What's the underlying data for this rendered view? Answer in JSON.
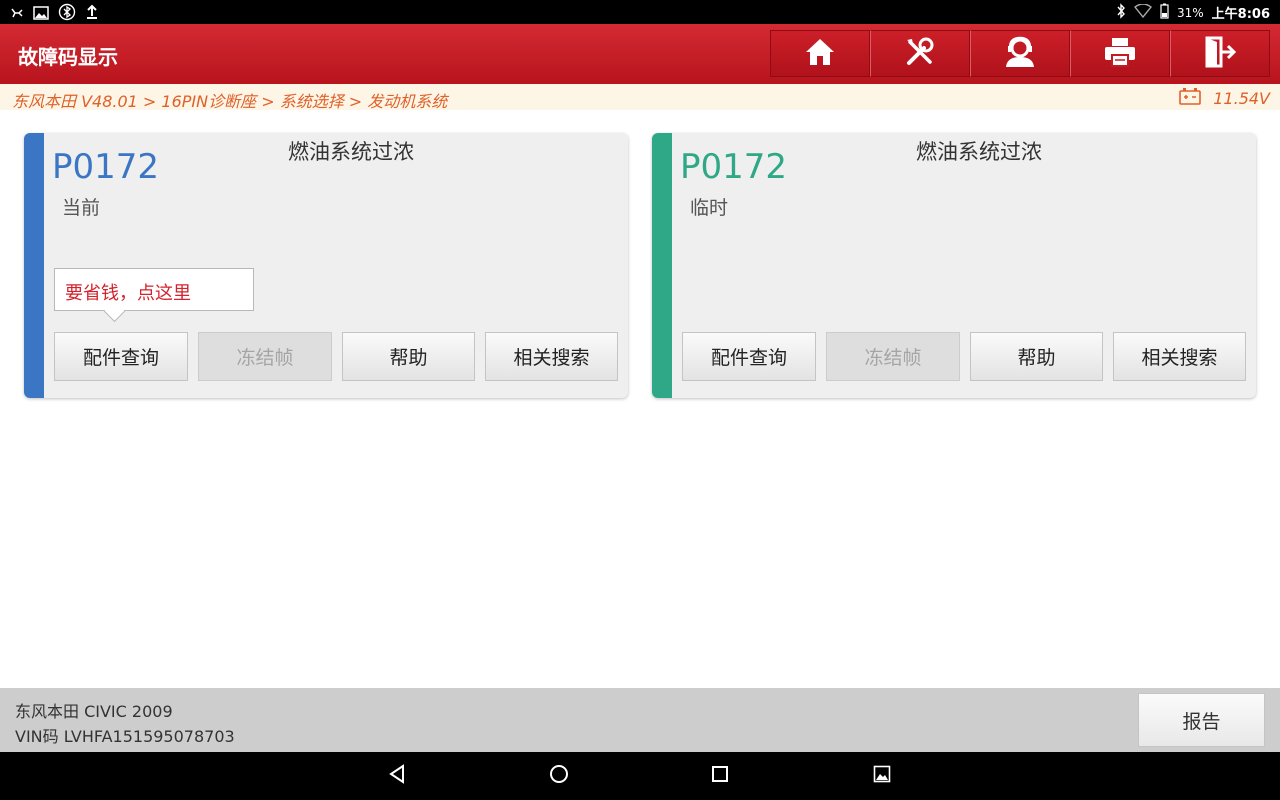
{
  "status_bar": {
    "battery_pct": "31%",
    "time": "上午8:06"
  },
  "header": {
    "title": "故障码显示",
    "toolbar": [
      {
        "icon": "home-icon"
      },
      {
        "icon": "diagnostic-tools-icon"
      },
      {
        "icon": "support-agent-icon"
      },
      {
        "icon": "print-icon"
      },
      {
        "icon": "exit-icon"
      }
    ]
  },
  "breadcrumb": {
    "path": "东风本田 V48.01 > 16PIN诊断座 > 系统选择 > 发动机系统",
    "voltage": "11.54V"
  },
  "dtc_cards": [
    {
      "code": "P0172",
      "status": "当前",
      "description": "燃油系统过浓",
      "accent_color": "#3a76c4",
      "tooltip": "要省钱，点这里",
      "buttons": [
        "配件查询",
        "冻结帧",
        "帮助",
        "相关搜索"
      ]
    },
    {
      "code": "P0172",
      "status": "临时",
      "description": "燃油系统过浓",
      "accent_color": "#2ea886",
      "buttons": [
        "配件查询",
        "冻结帧",
        "帮助",
        "相关搜索"
      ]
    }
  ],
  "footer": {
    "vehicle": "东风本田 CIVIC 2009",
    "vin": "VIN码 LVHFA151595078703",
    "report_label": "报告"
  },
  "colors": {
    "header_red": "#c41c25",
    "breadcrumb_text": "#e0602a",
    "tooltip_text": "#d4232c"
  }
}
